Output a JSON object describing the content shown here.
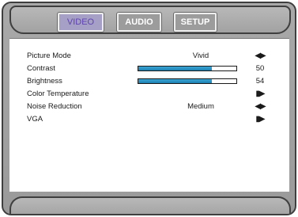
{
  "tabs": [
    {
      "label": "VIDEO",
      "active": true
    },
    {
      "label": "AUDIO",
      "active": false
    },
    {
      "label": "SETUP",
      "active": false
    }
  ],
  "menu": {
    "picture_mode": {
      "label": "Picture Mode",
      "value": "Vivid",
      "control_icon": "left-right-arrows-icon"
    },
    "contrast": {
      "label": "Contrast",
      "value": "50",
      "level_fraction": 0.75
    },
    "brightness": {
      "label": "Brightness",
      "value": "54",
      "level_fraction": 0.75
    },
    "color_temperature": {
      "label": "Color Temperature",
      "control_icon": "submenu-arrow-icon"
    },
    "noise_reduction": {
      "label": "Noise Reduction",
      "value": "Medium",
      "control_icon": "left-right-arrows-icon"
    },
    "vga": {
      "label": "VGA",
      "control_icon": "submenu-arrow-icon"
    }
  },
  "colors": {
    "active_tab_text": "#5e43b0",
    "slider_fill": "#2a93c7",
    "frame": "#a9a9a9"
  }
}
